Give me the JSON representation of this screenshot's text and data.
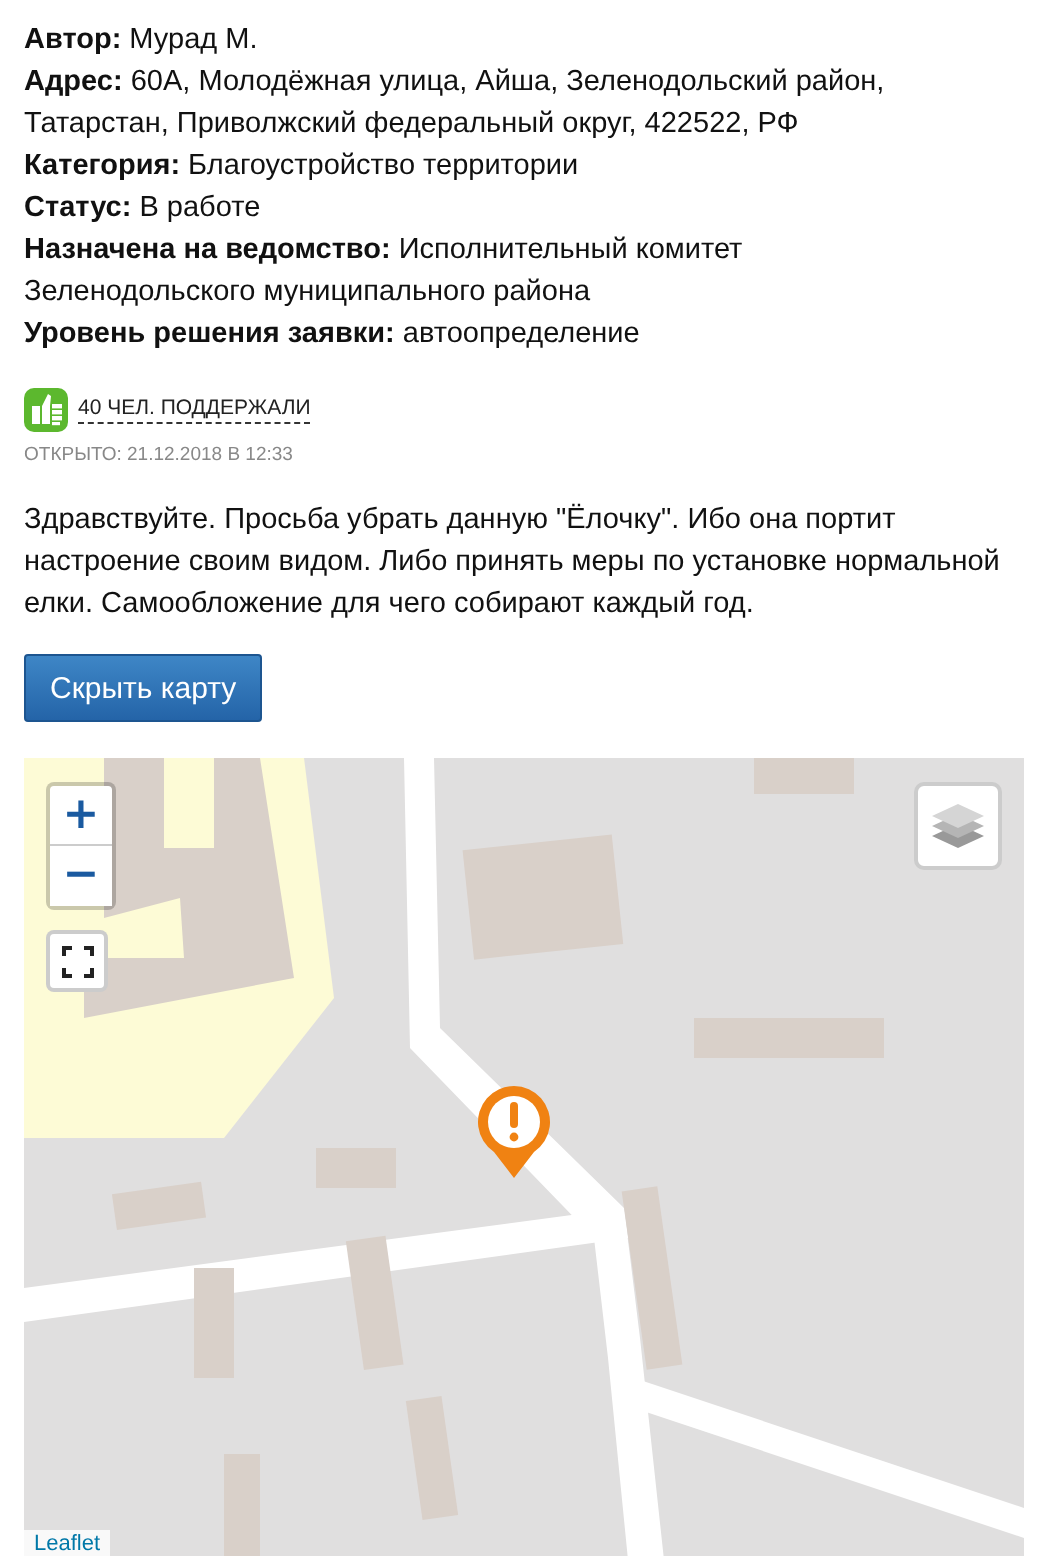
{
  "details": [
    "**Автор:** Мурад М.",
    "**Адрес:** 60А, Молодёжная улица, Айша, Зеленодольский район, Татарстан, Приволжский федеральный округ, 422522, РФ",
    "**Категория:** Благоустройство территории",
    "**Статус:** В работе",
    "**Назначена на ведомство:** Исполнительный комитет Зеленодольского муниципального района",
    "**Уровень решения заявки:** автоопределение"
  ],
  "support": {
    "label": "40 ЧЕЛ. ПОДДЕРЖАЛИ"
  },
  "opened": "ОТКРЫТО: 21.12.2018 В 12:33",
  "message": "Здравствуйте. Просьба убрать данную \"Ёлочку\". Ибо она портит настроение своим видом. Либо принять меры по установке нормальной елки. Самообложение для чего собирают каждый год.",
  "button": "Скрыть карту",
  "map": {
    "kind": "picture",
    "zoom_in": "+",
    "zoom_out": "−",
    "attribution": "Leaflet"
  }
}
